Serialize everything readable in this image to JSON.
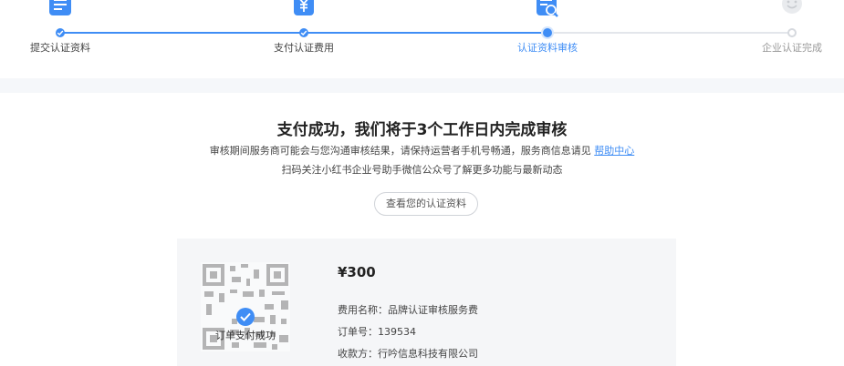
{
  "colors": {
    "accent": "#3f8df5",
    "muted": "#999999",
    "band": "#f5f7fa"
  },
  "steps": [
    {
      "label": "提交认证资料",
      "state": "done",
      "icon": "document-icon"
    },
    {
      "label": "支付认证费用",
      "state": "done",
      "icon": "yen-bill-icon"
    },
    {
      "label": "认证资料审核",
      "state": "active",
      "icon": "document-search-icon"
    },
    {
      "label": "企业认证完成",
      "state": "todo",
      "icon": "smile-icon"
    }
  ],
  "main": {
    "title": "支付成功，我们将于3个工作日内完成审核",
    "desc_line1": "审核期间服务商可能会与您沟通审核结果，请保持运营者手机号畅通，服务商信息请见",
    "help_link": "帮助中心",
    "desc_line2": "扫码关注小红书企业号助手微信公众号了解更多功能与最新动态",
    "view_button": "查看您的认证资料"
  },
  "order": {
    "paid_label": "订单支付成功",
    "amount": "¥300",
    "fee_name": "费用名称：品牌认证审核服务费",
    "order_no": "订单号：139534",
    "payee": "收款方：行吟信息科技有限公司"
  }
}
